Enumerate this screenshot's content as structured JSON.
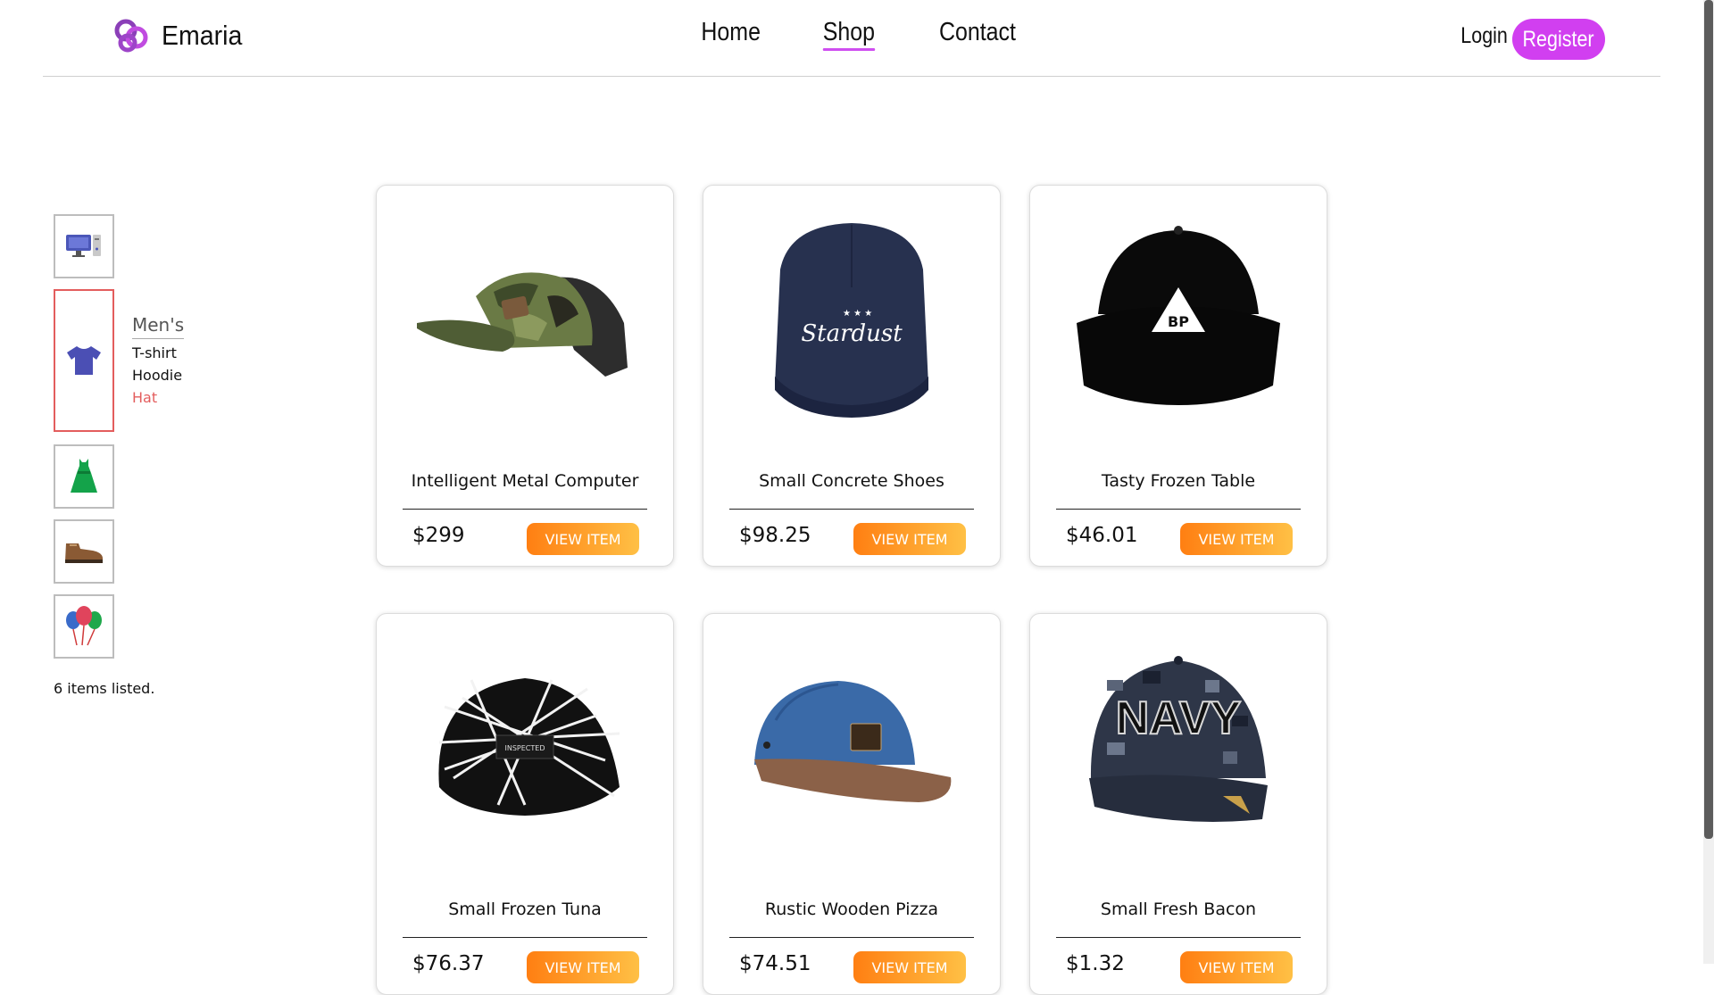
{
  "brand": {
    "name": "Emaria",
    "accent": "#d13ff0"
  },
  "nav": {
    "items": [
      "Home",
      "Shop",
      "Contact"
    ],
    "active": "Shop"
  },
  "auth": {
    "login": "Login",
    "register": "Register"
  },
  "sidebar": {
    "categories": [
      {
        "icon": "computer-icon"
      },
      {
        "icon": "tshirt-icon",
        "active": true
      },
      {
        "icon": "dress-icon"
      },
      {
        "icon": "shoe-icon"
      },
      {
        "icon": "balloons-icon"
      }
    ],
    "submenu": {
      "title": "Men's",
      "items": [
        "T-shirt",
        "Hoodie",
        "Hat"
      ],
      "active": "Hat"
    },
    "count_text": "6 items listed."
  },
  "products": [
    {
      "name": "Intelligent Metal Computer",
      "price": "$299",
      "button": "VIEW ITEM",
      "image": "camo-trucker-hat"
    },
    {
      "name": "Small Concrete Shoes",
      "price": "$98.25",
      "button": "VIEW ITEM",
      "image": "navy-stardust-cap"
    },
    {
      "name": "Tasty Frozen Table",
      "price": "$46.01",
      "button": "VIEW ITEM",
      "image": "black-bp-cap"
    },
    {
      "name": "Small Frozen Tuna",
      "price": "$76.37",
      "button": "VIEW ITEM",
      "image": "scribble-cap"
    },
    {
      "name": "Rustic Wooden Pizza",
      "price": "$74.51",
      "button": "VIEW ITEM",
      "image": "blue-suede-cap"
    },
    {
      "name": "Small Fresh Bacon",
      "price": "$1.32",
      "button": "VIEW ITEM",
      "image": "navy-camo-cap"
    }
  ],
  "card_text": {
    "stardust": "Stardust",
    "bp": "BP",
    "inspected": "INSPECTED",
    "navy": "NAVY"
  }
}
